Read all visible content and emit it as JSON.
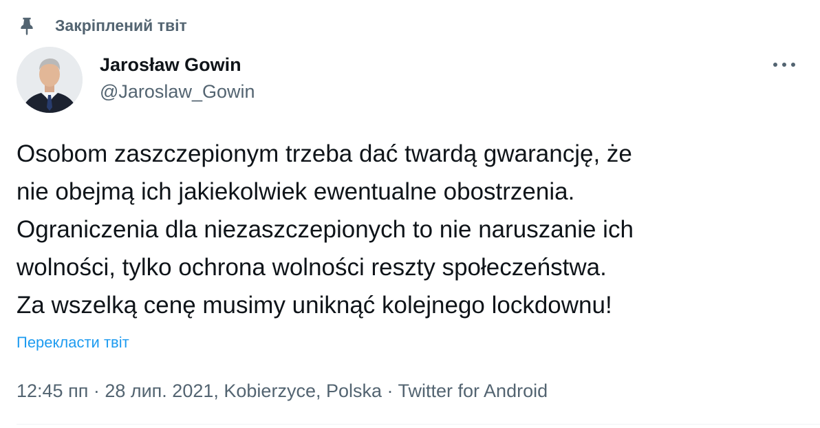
{
  "pinned": {
    "label": "Закріплений твіт",
    "icon": "pin-icon"
  },
  "author": {
    "name": "Jarosław Gowin",
    "handle": "@Jaroslaw_Gowin",
    "avatar_icon": "avatar-photo"
  },
  "menu": {
    "icon": "more-horizontal-icon"
  },
  "tweet": {
    "lines": [
      "Osobom zaszczepionym trzeba dać twardą gwarancję, że",
      "nie obejmą ich jakiekolwiek ewentualne obostrzenia.",
      "Ograniczenia dla niezaszczepionych to nie naruszanie ich",
      "wolności, tylko ochrona wolności reszty społeczeństwa.",
      "Za wszelką cenę musimy uniknąć kolejnego lockdownu!"
    ]
  },
  "translate": {
    "label": "Перекласти твіт"
  },
  "meta": {
    "time": "12:45 пп",
    "separator": " · ",
    "date": "28 лип. 2021",
    "location_prefix": ", ",
    "location": "Kobierzyce, Polska",
    "source": "Twitter for Android"
  },
  "colors": {
    "text": "#0f1419",
    "secondary": "#536471",
    "link": "#1d9bf0",
    "divider": "#eff3f4"
  }
}
